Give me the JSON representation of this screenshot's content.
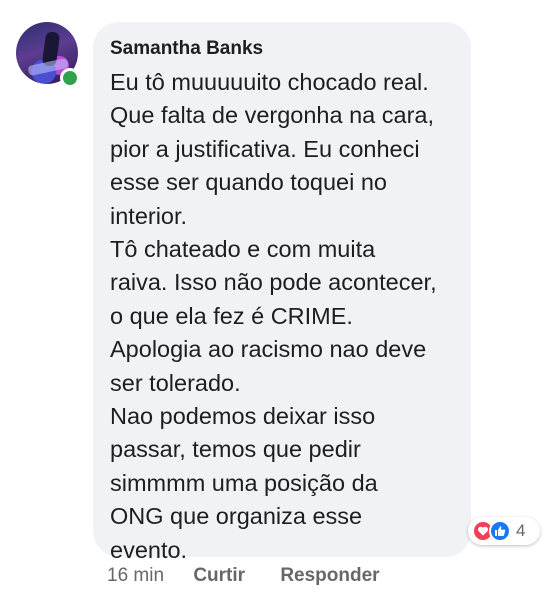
{
  "comment": {
    "author": "Samantha Banks",
    "body_lines": [
      "Eu tô muuuuuito chocado real.",
      "Que falta de vergonha na cara,",
      "pior a justificativa. Eu conheci",
      "esse ser quando toquei no",
      "interior.",
      "Tô chateado e com muita",
      "raiva. Isso não pode acontecer,",
      "o que ela fez é CRIME.",
      "Apologia ao racismo nao deve",
      "ser tolerado.",
      "Nao podemos deixar isso",
      "passar, temos que pedir",
      "simmmm uma posição da",
      "ONG que organiza esse",
      "evento."
    ],
    "reactions": {
      "icons": [
        "love-icon",
        "like-icon"
      ],
      "count": "4"
    },
    "time": "16 min",
    "actions": {
      "like_label": "Curtir",
      "reply_label": "Responder"
    }
  },
  "colors": {
    "bubble_bg": "#f0f2f5",
    "text": "#1c1e21",
    "secondary_text": "#65676b",
    "online": "#31a24c",
    "love": "#f33e58",
    "like": "#1877f2"
  }
}
